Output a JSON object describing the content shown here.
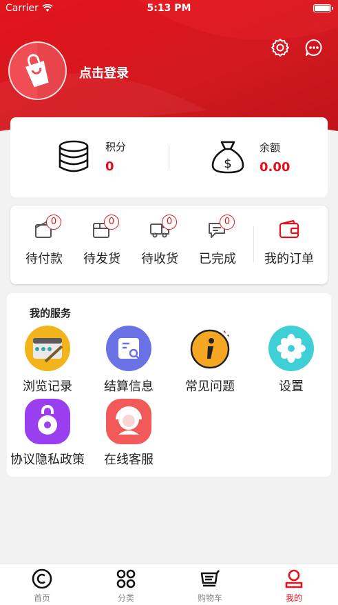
{
  "status_bar": {
    "carrier": "Carrier",
    "time": "5:13 PM"
  },
  "header": {
    "login_label": "点击登录"
  },
  "account": {
    "points": {
      "label": "积分",
      "value": "0"
    },
    "balance": {
      "label": "余额",
      "value": "0.00"
    }
  },
  "orders": {
    "items": [
      {
        "label": "待付款",
        "count": "0"
      },
      {
        "label": "待发货",
        "count": "0"
      },
      {
        "label": "待收货",
        "count": "0"
      },
      {
        "label": "已完成",
        "count": "0"
      }
    ],
    "all_label": "我的订单"
  },
  "services": {
    "title": "我的服务",
    "items": [
      {
        "label": "浏览记录",
        "icon": "browse-history-icon"
      },
      {
        "label": "结算信息",
        "icon": "settlement-info-icon"
      },
      {
        "label": "常见问题",
        "icon": "faq-icon"
      },
      {
        "label": "设置",
        "icon": "flower-settings-icon"
      },
      {
        "label": "协议隐私政策",
        "icon": "privacy-lock-icon"
      },
      {
        "label": "在线客服",
        "icon": "customer-service-icon"
      }
    ]
  },
  "tab_bar": {
    "tabs": [
      {
        "label": "首页",
        "icon": "home-icon",
        "active": false
      },
      {
        "label": "分类",
        "icon": "category-icon",
        "active": false
      },
      {
        "label": "购物车",
        "icon": "cart-icon",
        "active": false
      },
      {
        "label": "我的",
        "icon": "profile-icon",
        "active": true
      }
    ]
  },
  "colors": {
    "brand_red": "#e8101a",
    "header_red": "#d81a22",
    "text": "#222222",
    "muted": "#888888"
  }
}
